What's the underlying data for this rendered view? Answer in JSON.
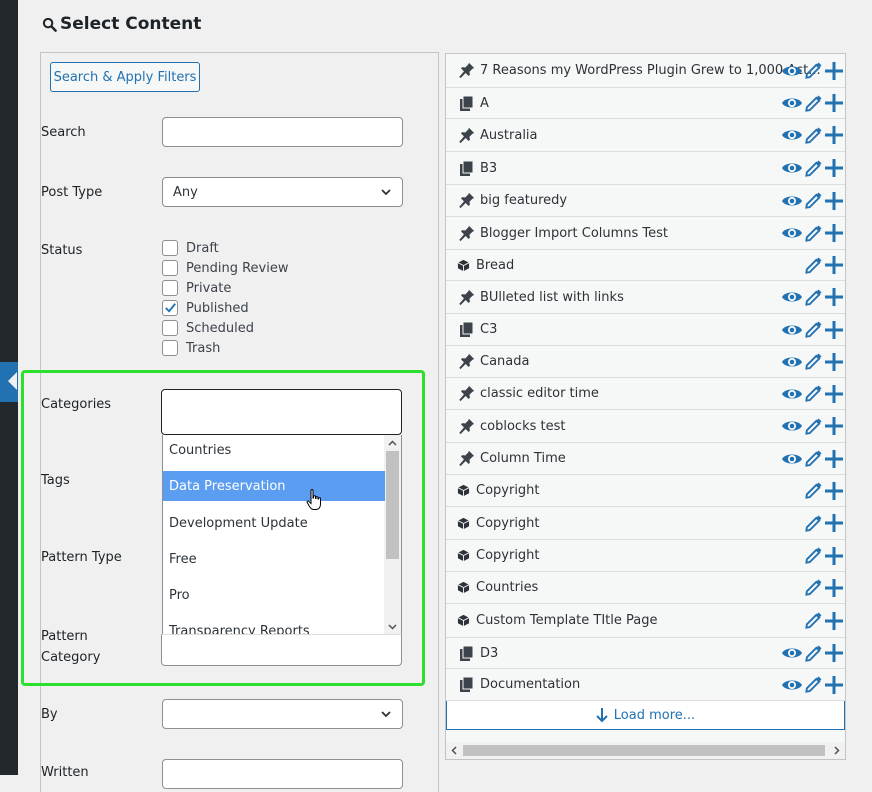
{
  "header": {
    "title": "Select Content"
  },
  "filters": {
    "apply_button": "Search & Apply Filters",
    "search_label": "Search",
    "search_value": "",
    "post_type_label": "Post Type",
    "post_type_value": "Any",
    "status_label": "Status",
    "statuses": [
      {
        "label": "Draft",
        "checked": false
      },
      {
        "label": "Pending Review",
        "checked": false
      },
      {
        "label": "Private",
        "checked": false
      },
      {
        "label": "Published",
        "checked": true
      },
      {
        "label": "Scheduled",
        "checked": false
      },
      {
        "label": "Trash",
        "checked": false
      }
    ],
    "categories_label": "Categories",
    "tags_label": "Tags",
    "pattern_type_label": "Pattern Type",
    "pattern_category_label": "Pattern Category",
    "pattern_category_line1": "Pattern",
    "pattern_category_line2": "Category",
    "by_label": "By",
    "by_value": "",
    "written_label": "Written",
    "category_options": [
      {
        "label": "Countries",
        "selected": false
      },
      {
        "label": "Data Preservation",
        "selected": true
      },
      {
        "label": "Development Update",
        "selected": false
      },
      {
        "label": "Free",
        "selected": false
      },
      {
        "label": "Pro",
        "selected": false
      },
      {
        "label": "Transparency Reports",
        "selected": false
      }
    ]
  },
  "results": {
    "items": [
      {
        "title": "7 Reasons my WordPress Plugin Grew to 1,000 Act...",
        "icon": "pin-icon",
        "actions": [
          "view",
          "edit",
          "add"
        ]
      },
      {
        "title": "A",
        "icon": "pages-icon",
        "actions": [
          "view",
          "edit",
          "add"
        ]
      },
      {
        "title": "Australia",
        "icon": "pin-icon",
        "actions": [
          "view",
          "edit",
          "add"
        ]
      },
      {
        "title": "B3",
        "icon": "pages-icon",
        "actions": [
          "view",
          "edit",
          "add"
        ]
      },
      {
        "title": "big featuredy",
        "icon": "pin-icon",
        "actions": [
          "view",
          "edit",
          "add"
        ]
      },
      {
        "title": "Blogger Import Columns Test",
        "icon": "pin-icon",
        "actions": [
          "view",
          "edit",
          "add"
        ]
      },
      {
        "title": "Bread",
        "icon": "block-icon",
        "actions": [
          "edit",
          "add"
        ]
      },
      {
        "title": "BUlleted list with links",
        "icon": "pin-icon",
        "actions": [
          "view",
          "edit",
          "add"
        ]
      },
      {
        "title": "C3",
        "icon": "pages-icon",
        "actions": [
          "view",
          "edit",
          "add"
        ]
      },
      {
        "title": "Canada",
        "icon": "pin-icon",
        "actions": [
          "view",
          "edit",
          "add"
        ]
      },
      {
        "title": "classic editor time",
        "icon": "pin-icon",
        "actions": [
          "view",
          "edit",
          "add"
        ]
      },
      {
        "title": "coblocks test",
        "icon": "pin-icon",
        "actions": [
          "view",
          "edit",
          "add"
        ]
      },
      {
        "title": "Column Time",
        "icon": "pin-icon",
        "actions": [
          "view",
          "edit",
          "add"
        ]
      },
      {
        "title": "Copyright",
        "icon": "block-icon",
        "actions": [
          "edit",
          "add"
        ]
      },
      {
        "title": "Copyright",
        "icon": "block-icon",
        "actions": [
          "edit",
          "add"
        ]
      },
      {
        "title": "Copyright",
        "icon": "block-icon",
        "actions": [
          "edit",
          "add"
        ]
      },
      {
        "title": "Countries",
        "icon": "block-icon",
        "actions": [
          "edit",
          "add"
        ]
      },
      {
        "title": "Custom Template TItle Page",
        "icon": "block-icon",
        "actions": [
          "edit",
          "add"
        ]
      },
      {
        "title": "D3",
        "icon": "pages-icon",
        "actions": [
          "view",
          "edit",
          "add"
        ]
      },
      {
        "title": "Documentation",
        "icon": "pages-icon",
        "actions": [
          "view",
          "edit",
          "add"
        ]
      }
    ],
    "load_more": "Load more..."
  },
  "colors": {
    "accent": "#2271b1",
    "highlight_box": "#2ee02e",
    "selected_option": "#5b9df0"
  }
}
